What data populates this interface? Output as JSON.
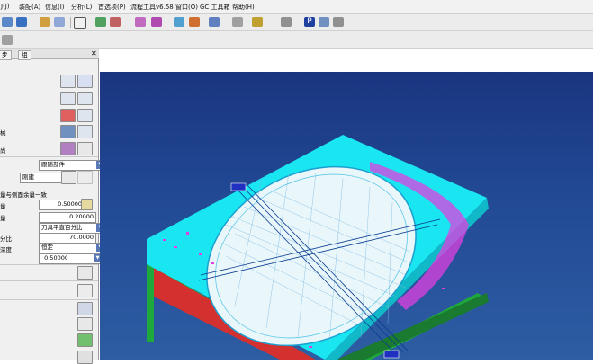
{
  "menubar": {
    "items": [
      "J(J)",
      "装配(A)",
      "信息(I)",
      "分析(L)",
      "首选项(P)",
      "流程工具v6.58",
      "窗口(O)",
      "GC 工具箱",
      "帮助(H)"
    ]
  },
  "panel": {
    "tabs": [
      "步",
      "组"
    ],
    "labels": {
      "cut_method": "械",
      "geometry": "尚",
      "stock_side": "量与侧面余量一致",
      "floor_stock": "量",
      "stepover": "刀具平直百分比",
      "pattern_label": "分比",
      "cut_order_label": "深度"
    },
    "select_method": "跟随部件",
    "select_geom": "刚建",
    "part_stock": "0.50000",
    "floor_stock": "0.20000",
    "stepover_type": "刀具平直百分比",
    "percent": "70.0000",
    "cut_depth_type": "恒定",
    "cut_depth": "0.50000"
  },
  "colors": {
    "viewport_top": "#1a3580",
    "viewport_bottom": "#2d5da3",
    "part_cyan": "#19e6f0",
    "part_green": "#1fa83c",
    "part_red": "#d43030",
    "toolpath_magenta": "#e040e0"
  },
  "icons": [
    "save-icon",
    "cube-icon",
    "pointer-icon",
    "sketch-icon",
    "view-icon",
    "layer-icon",
    "snap-icon",
    "p-icon",
    "generate-icon",
    "verify-icon"
  ]
}
